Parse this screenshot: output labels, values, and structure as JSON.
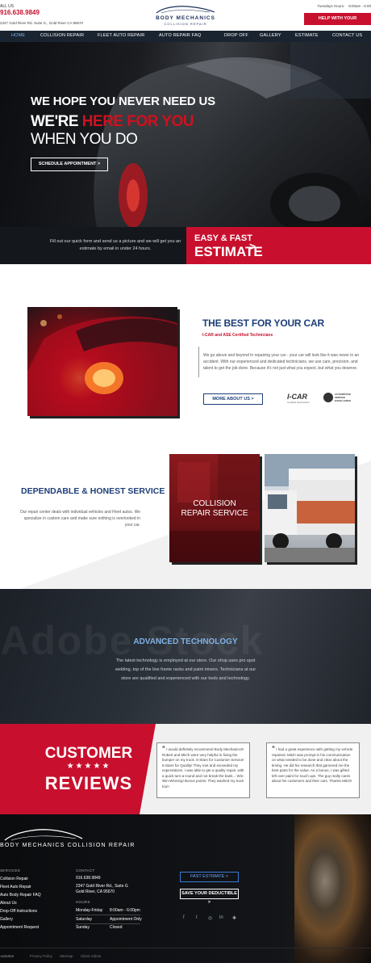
{
  "topbar": {
    "call_label": "ALL US",
    "phone": "916.638.9849",
    "address": "2347 Gold River Rd. Suite G., Gold River CA 95670",
    "hours_label": "Tuesdays Hours:",
    "hours_value": "8:00am - 6:00",
    "deductible_button": "HELP WITH YOUR DEDUCTIBLE"
  },
  "logo": {
    "name": "BODY MECHANICS",
    "sub": "COLLISION REPAIR"
  },
  "nav": [
    {
      "label": "HOME",
      "active": true
    },
    {
      "label": "COLLISION REPAIR",
      "active": false
    },
    {
      "label": "FLEET AUTO REPAIR",
      "active": false
    },
    {
      "label": "AUTO REPAIR FAQ",
      "active": false
    },
    {
      "label": "DROP OFF",
      "active": false
    },
    {
      "label": "GALLERY",
      "active": false
    },
    {
      "label": "ESTIMATE",
      "active": false
    },
    {
      "label": "CONTACT US",
      "active": false
    }
  ],
  "hero": {
    "line1_a": "WE HOPE YOU ",
    "line1_b": "NEVER",
    "line1_c": " NEED US",
    "line2_a": "WE'RE ",
    "line2_b": "HERE FOR YOU",
    "line3": "WHEN YOU DO",
    "button": "SCHEDULE APPOINTMENT >"
  },
  "estimate_bar": {
    "text": "Fill out our quick form and send us a picture and we will get you an estimate by email in under 24 hours.",
    "line1": "EASY & FAST",
    "line2": "ESTIMATE",
    "arrow": ">"
  },
  "best": {
    "title": "THE BEST FOR YOUR CAR",
    "subtitle": "I-CAR and ASE Certified Technicians",
    "body": "We go above and beyond in repairing your car - your car will look like it was never in an accident. With our experienced and dedicated technicians, we use care, precision, and talent to get the job done. Because it's not just what you expect, but what you deserve.",
    "more_button": "MORE ABOUT US >",
    "icar_label": "I-CAR",
    "icar_sub": "Certified Technicians",
    "ase_label": "AUTOMOTIVE SERVICE EXCELLENCE"
  },
  "dependable": {
    "title": "DEPENDABLE & HONEST SERVICE",
    "body": "Our repair center deals with individual vehicles and Fleet autos. We specialize in custom care and make sure nothing is overlooked in your car.",
    "collision_line1": "COLLISION",
    "collision_line2": "REPAIR SERVICE"
  },
  "advanced": {
    "title": "ADVANCED TECHNOLOGY",
    "body": "The latest technology is employed at our store. Our shop uses pro spot welding, top of the line frame racks and paint mixers. Technicians at our store are qualified and experienced with our tools and technology.",
    "watermark": "Adobe Stock"
  },
  "reviews": {
    "line1": "CUSTOMER",
    "stars": "★★★★★",
    "line2": "REVIEWS",
    "cards": [
      {
        "text": "I would definitely recommend Body Mechanics!!! Robert and Mitch were very helpful in fixing the bumper on my truck. 5-Stars for Customer Service! 5-Stars for Quality! They met and exceeded my expectations. I was able to get a quality repair, with a quick turn-a-round and not break the bank... Win-Win-Winning! Bonus points: They washed my truck too!!"
      },
      {
        "text": "I had a great experience with getting my vehicle repaired. Mitch was prompt in his communication on what needed to be done and clear about the timing. He did his research that garnered me the best parts for the value. As a bonus, I was gifted left over paint for touch ups. The guy really cares about his customers and their cars. Thanks Mitch!"
      }
    ]
  },
  "footer": {
    "brand": "BODY MECHANICS   COLLISION REPAIR",
    "services_heading": "SERVICES",
    "services": [
      "Collision Repair",
      "Fleet Auto Repair",
      "Auto Body Repair FAQ",
      "About Us",
      "Drop-Off Instructions",
      "Gallery",
      "Appointment Request"
    ],
    "contact_heading": "CONTACT",
    "phone": "916.638.9849",
    "address1": "2347 Gold River Rd., Suite G",
    "address2": "Gold River, CA 95670",
    "hours_heading": "HOURS",
    "hours": [
      {
        "day": "Monday-Friday",
        "time": "8:00am - 6:00pm"
      },
      {
        "day": "Saturday",
        "time": "Appointment Only"
      },
      {
        "day": "Sunday",
        "time": "Closed"
      }
    ],
    "fast_estimate_button": "FAST ESTIMATE >",
    "save_deductible_button": "SAVE YOUR DEDUCTIBLE >",
    "social": [
      "facebook-icon",
      "twitter-icon",
      "instagram-icon",
      "linkedin-icon",
      "yelp-icon"
    ],
    "social_glyphs": [
      "f",
      "t",
      "◎",
      "in",
      "✱"
    ],
    "legal_brand": "AutoStar",
    "legal_links": [
      "Privacy Policy",
      "Sitemap",
      "Client Admin"
    ]
  }
}
